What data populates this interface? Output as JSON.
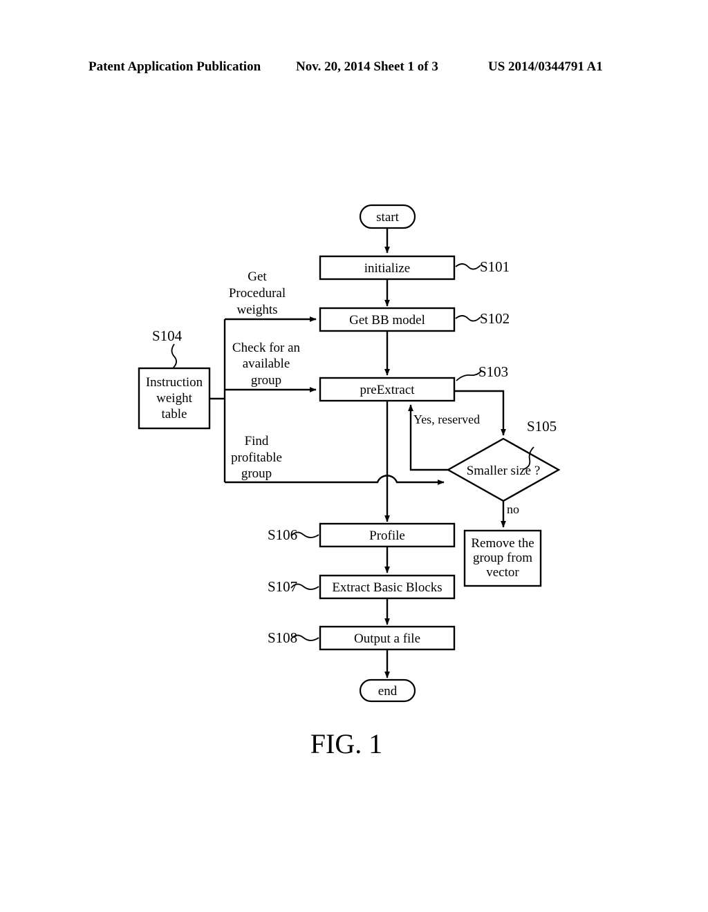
{
  "header": {
    "publication": "Patent Application Publication",
    "date_sheet": "Nov. 20, 2014  Sheet 1 of 3",
    "patent_number": "US 2014/0344791 A1"
  },
  "figure": {
    "caption": "FIG. 1"
  },
  "nodes": {
    "start": {
      "label": "start",
      "type": "terminator"
    },
    "initialize": {
      "label": "initialize",
      "type": "process",
      "ref": "S101"
    },
    "get_bb_model": {
      "label": "Get BB model",
      "type": "process",
      "ref": "S102"
    },
    "pre_extract": {
      "label": "preExtract",
      "type": "process",
      "ref": "S103"
    },
    "instruction_weight_table": {
      "label_line1": "Instruction",
      "label_line2": "weight",
      "label_line3": "table",
      "type": "data-store",
      "ref": "S104"
    },
    "smaller_size": {
      "label": "Smaller size ?",
      "type": "decision",
      "ref": "S105"
    },
    "remove_group": {
      "label_line1": "Remove the",
      "label_line2": "group from",
      "label_line3": "vector",
      "type": "process"
    },
    "profile": {
      "label": "Profile",
      "type": "process",
      "ref": "S106"
    },
    "extract_basic_blocks": {
      "label": "Extract Basic Blocks",
      "type": "process",
      "ref": "S107"
    },
    "output_a_file": {
      "label": "Output a file",
      "type": "process",
      "ref": "S108"
    },
    "end": {
      "label": "end",
      "type": "terminator"
    }
  },
  "annotations": {
    "get_procedural_weights": {
      "line1": "Get",
      "line2": "Procedural",
      "line3": "weights"
    },
    "check_available_group": {
      "line1": "Check for an",
      "line2": "available",
      "line3": "group"
    },
    "find_profitable_group": {
      "line1": "Find",
      "line2": "profitable",
      "line3": "group"
    }
  },
  "edge_labels": {
    "yes_reserved": "Yes, reserved",
    "no": "no"
  },
  "colors": {
    "stroke": "#000000",
    "fill": "#ffffff",
    "text": "#000000"
  }
}
